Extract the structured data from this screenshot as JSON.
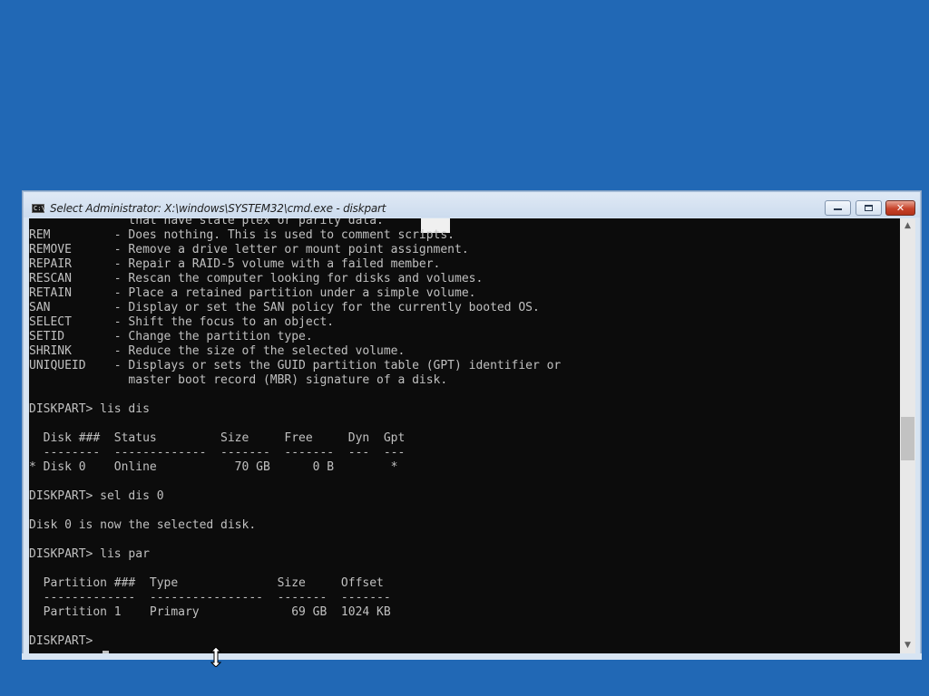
{
  "window": {
    "title": "Select Administrator: X:\\windows\\SYSTEM32\\cmd.exe - diskpart",
    "icon": "cmd-icon",
    "icon_glyph": "C:\\",
    "buttons": {
      "minimize": "minimize-icon",
      "maximize": "maximize-icon",
      "close_glyph": "✕"
    }
  },
  "console": {
    "lines": [
      "              that have stale plex or parity data.",
      "REM         - Does nothing. This is used to comment scripts.",
      "REMOVE      - Remove a drive letter or mount point assignment.",
      "REPAIR      - Repair a RAID-5 volume with a failed member.",
      "RESCAN      - Rescan the computer looking for disks and volumes.",
      "RETAIN      - Place a retained partition under a simple volume.",
      "SAN         - Display or set the SAN policy for the currently booted OS.",
      "SELECT      - Shift the focus to an object.",
      "SETID       - Change the partition type.",
      "SHRINK      - Reduce the size of the selected volume.",
      "UNIQUEID    - Displays or sets the GUID partition table (GPT) identifier or",
      "              master boot record (MBR) signature of a disk.",
      "",
      "DISKPART> lis dis",
      "",
      "  Disk ###  Status         Size     Free     Dyn  Gpt",
      "  --------  -------------  -------  -------  ---  ---",
      "* Disk 0    Online           70 GB      0 B        *",
      "",
      "DISKPART> sel dis 0",
      "",
      "Disk 0 is now the selected disk.",
      "",
      "DISKPART> lis par",
      "",
      "  Partition ###  Type              Size     Offset",
      "  -------------  ----------------  -------  -------",
      "  Partition 1    Primary             69 GB  1024 KB",
      "",
      "DISKPART> "
    ]
  },
  "colors": {
    "desktop": "#2168b5",
    "console_bg": "#0c0c0c",
    "console_fg": "#c0c0c0"
  }
}
